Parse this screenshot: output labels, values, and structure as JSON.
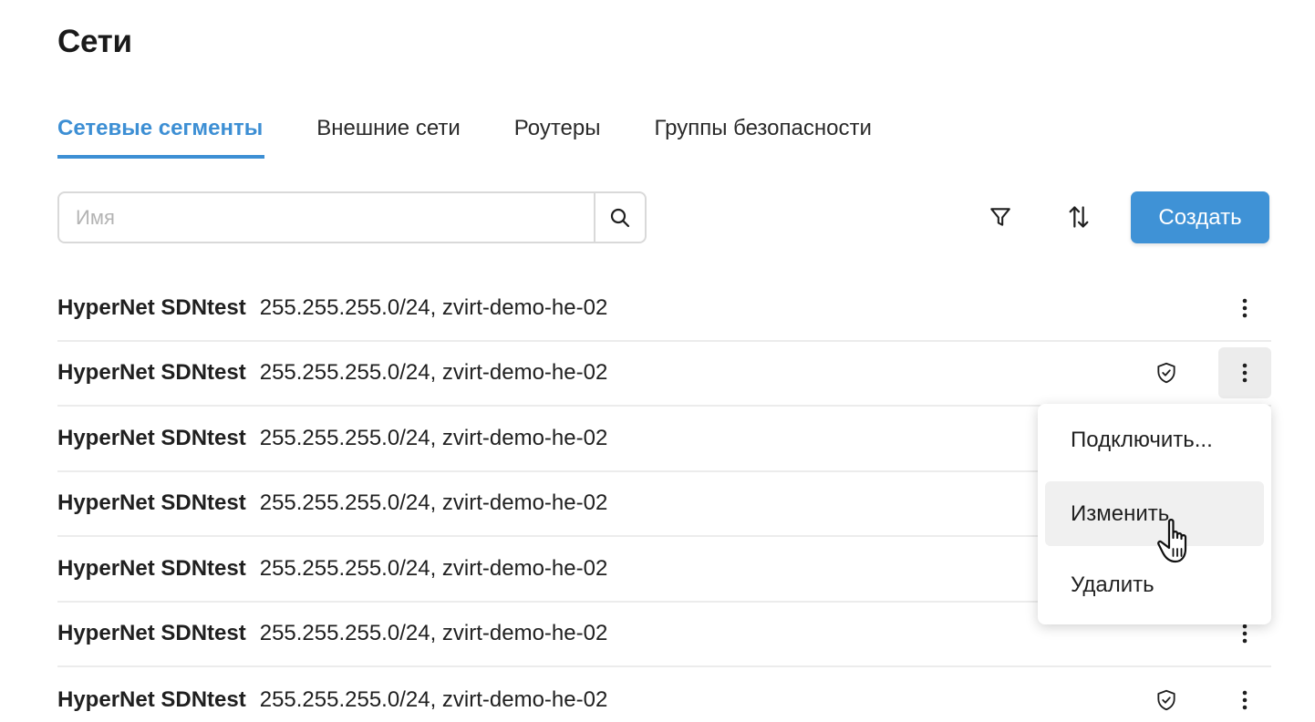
{
  "page": {
    "title": "Сети"
  },
  "tabs": [
    {
      "label": "Сетевые сегменты",
      "active": true
    },
    {
      "label": "Внешние сети",
      "active": false
    },
    {
      "label": "Роутеры",
      "active": false
    },
    {
      "label": "Группы безопасности",
      "active": false
    }
  ],
  "search": {
    "placeholder": "Имя",
    "value": "",
    "icon": "search-icon"
  },
  "toolbar": {
    "filter_icon": "filter-icon",
    "sort_icon": "sort-icon",
    "create_label": "Создать"
  },
  "rows": [
    {
      "name": "HyperNet SDNtest",
      "details": "255.255.255.0/24, zvirt-demo-he-02",
      "shield": false,
      "menu_open": false
    },
    {
      "name": "HyperNet SDNtest",
      "details": "255.255.255.0/24, zvirt-demo-he-02",
      "shield": true,
      "menu_open": true
    },
    {
      "name": "HyperNet SDNtest",
      "details": "255.255.255.0/24, zvirt-demo-he-02",
      "shield": false,
      "menu_open": false
    },
    {
      "name": "HyperNet SDNtest",
      "details": "255.255.255.0/24, zvirt-demo-he-02",
      "shield": false,
      "menu_open": false
    },
    {
      "name": "HyperNet SDNtest",
      "details": "255.255.255.0/24, zvirt-demo-he-02",
      "shield": false,
      "menu_open": false
    },
    {
      "name": "HyperNet SDNtest",
      "details": "255.255.255.0/24, zvirt-demo-he-02",
      "shield": false,
      "menu_open": false
    },
    {
      "name": "HyperNet SDNtest",
      "details": "255.255.255.0/24, zvirt-demo-he-02",
      "shield": true,
      "menu_open": false
    }
  ],
  "context_menu": {
    "items": [
      {
        "label": "Подключить...",
        "hover": false
      },
      {
        "label": "Изменить",
        "hover": true
      },
      {
        "label": "Удалить",
        "hover": false
      }
    ]
  },
  "colors": {
    "accent": "#3d8fd4",
    "button": "#3f92d6",
    "divider": "#ececec",
    "text": "#1f1f1f"
  }
}
